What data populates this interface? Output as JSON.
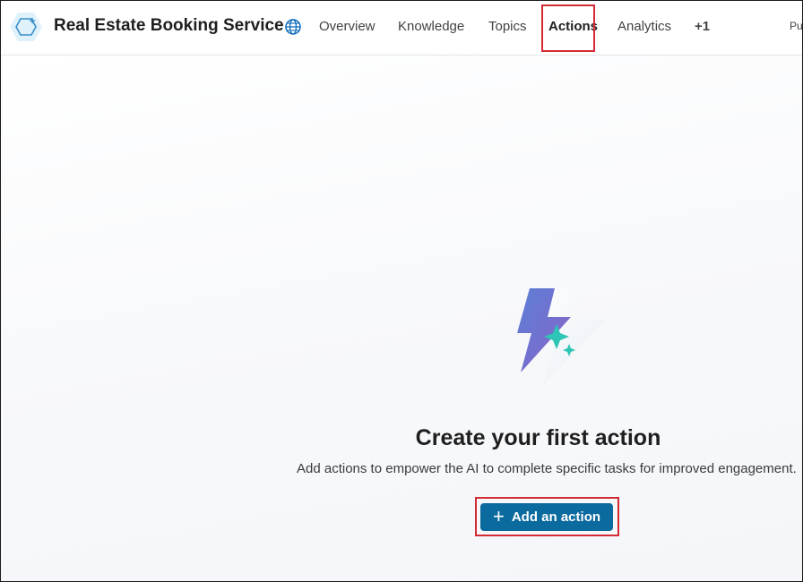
{
  "header": {
    "app_title": "Real Estate Booking Service",
    "logo_icon": "copilot-hexagon-icon",
    "globe_icon": "globe-icon",
    "tabs": [
      {
        "label": "Overview",
        "active": false
      },
      {
        "label": "Knowledge",
        "active": false
      },
      {
        "label": "Topics",
        "active": false
      },
      {
        "label": "Actions",
        "active": true
      },
      {
        "label": "Analytics",
        "active": false
      }
    ],
    "more_tabs": "+1",
    "publish_label": "Pu"
  },
  "empty_state": {
    "illustration_icon": "lightning-sparkle-icon",
    "title": "Create your first action",
    "description": "Add actions to empower the AI to complete specific tasks for improved engagement.",
    "button_label": "Add an action",
    "button_icon": "plus-icon"
  },
  "colors": {
    "accent": "#0b6a9e",
    "highlight": "#d42a33"
  }
}
